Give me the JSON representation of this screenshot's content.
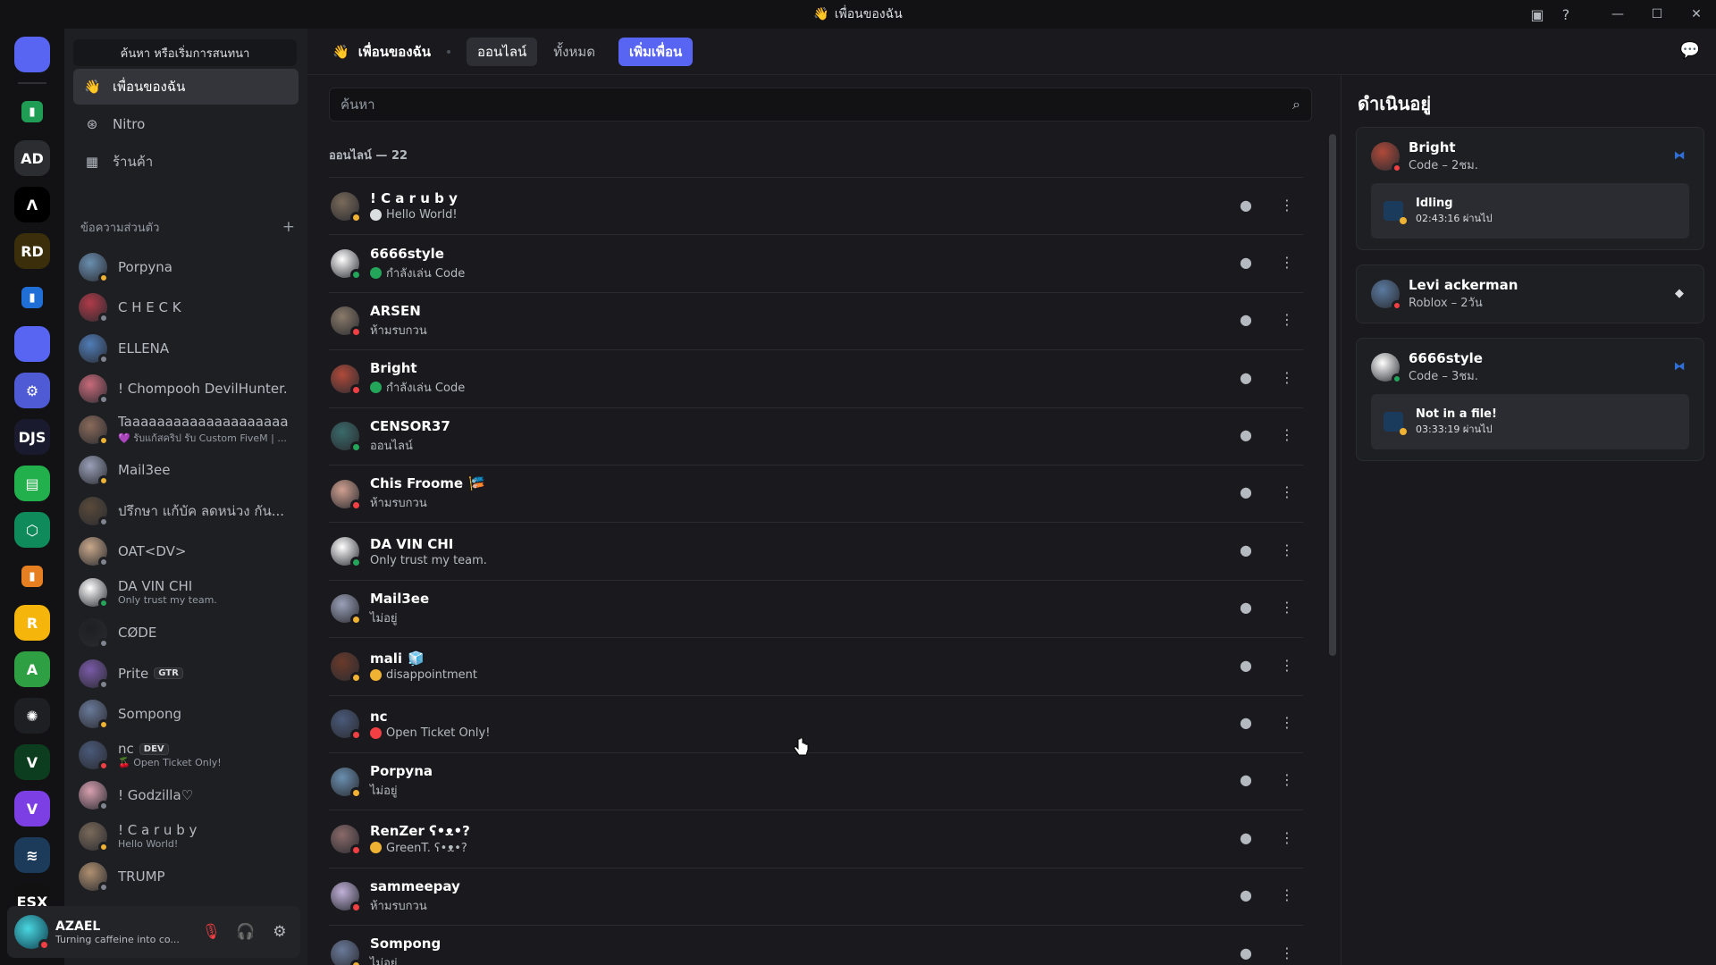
{
  "window": {
    "title": "เพื่อนของฉัน"
  },
  "guilds": [
    {
      "label": "",
      "color": "#5865f2",
      "icon": "discord-home-icon"
    },
    {
      "label": "▮",
      "color": "#1f9d55",
      "icon": "folder-green-icon",
      "folder": true
    },
    {
      "label": "AD",
      "color": "#2b2d31",
      "icon": "ad-server-icon"
    },
    {
      "label": "Ʌ",
      "color": "#000000",
      "icon": "ar-server-icon"
    },
    {
      "label": "RD",
      "color": "#3a2f0a",
      "icon": "rd-server-icon"
    },
    {
      "label": "▮",
      "color": "#1f6fd6",
      "icon": "folder-blue-icon",
      "folder": true
    },
    {
      "label": "",
      "color": "#5865f2",
      "icon": "discord-server-icon"
    },
    {
      "label": "⚙",
      "color": "#4f5bd5",
      "icon": "bot-server-icon"
    },
    {
      "label": "DJS",
      "color": "#1a1a2e",
      "icon": "djs-server-icon"
    },
    {
      "label": "▤",
      "color": "#21b04c",
      "icon": "sheets-server-icon"
    },
    {
      "label": "⬡",
      "color": "#0f8a5b",
      "icon": "hex-server-icon"
    },
    {
      "label": "▮",
      "color": "#e67e22",
      "icon": "folder-orange-icon",
      "folder": true
    },
    {
      "label": "R",
      "color": "#f5b50a",
      "icon": "r-server-icon"
    },
    {
      "label": "A",
      "color": "#2ea043",
      "icon": "a-server-icon"
    },
    {
      "label": "✺",
      "color": "#1e1f23",
      "icon": "atom-server-icon"
    },
    {
      "label": "V",
      "color": "#0b3d1e",
      "icon": "v-server-icon"
    },
    {
      "label": "V",
      "color": "#7b3fe4",
      "icon": "vite-server-icon"
    },
    {
      "label": "≋",
      "color": "#1c3a5a",
      "icon": "wave-server-icon"
    },
    {
      "label": "ESX",
      "color": "#111111",
      "icon": "esx-server-icon"
    }
  ],
  "sidebar": {
    "search_label": "ค้นหา หรือเริ่มการสนทนา",
    "nav": [
      {
        "label": "เพื่อนของฉัน",
        "icon": "friends-icon",
        "active": true
      },
      {
        "label": "Nitro",
        "icon": "nitro-icon",
        "active": false
      },
      {
        "label": "ร้านค้า",
        "icon": "shop-icon",
        "active": false
      }
    ],
    "dm_header": "ข้อความส่วนตัว",
    "dm_add": "+",
    "dms": [
      {
        "name": "Porpyna",
        "sub": "",
        "color": "#6a8fb0",
        "status": "#f0b232"
      },
      {
        "name": "C H E C K",
        "sub": "",
        "color": "#b03a48",
        "status": "#80848e"
      },
      {
        "name": "ELLENA",
        "sub": "",
        "color": "#4f7db8",
        "status": "#80848e"
      },
      {
        "name": "! Chompooh DevilHunter...",
        "sub": "",
        "color": "#c96a7a",
        "status": "#80848e"
      },
      {
        "name": "Taaaaaaaaaaaaaaaaaaaa...",
        "sub": "💜 รับแก้สคริป รับ Custom FiveM | ...",
        "color": "#8a6a5a",
        "status": "#f0b232"
      },
      {
        "name": "Mail3ee",
        "sub": "",
        "color": "#9aa0b8",
        "status": "#f0b232"
      },
      {
        "name": "ปรึกษา แก้บัค ลดหน่วง กัน...",
        "sub": "",
        "color": "#5a4a3a",
        "status": "#80848e"
      },
      {
        "name": "OAT<DV>",
        "sub": "",
        "color": "#c9a88a",
        "status": "#80848e"
      },
      {
        "name": "DA VIN CHI",
        "sub": "Only trust my team.",
        "color": "#ffffff",
        "status": "#23a55a"
      },
      {
        "name": "CØDE",
        "sub": "",
        "color": "#1e1f23",
        "status": "#80848e"
      },
      {
        "name": "Prite",
        "sub": "",
        "tag": "GTR",
        "color": "#7a5aa8",
        "status": "#80848e"
      },
      {
        "name": "Sompong",
        "sub": "",
        "color": "#6a7a9a",
        "status": "#f0b232"
      },
      {
        "name": "nc",
        "sub": "🍒 Open Ticket Only!",
        "tag": "DEV",
        "color": "#4a5a7a",
        "status": "#f23f43"
      },
      {
        "name": "! Godzilla♡",
        "sub": "",
        "color": "#d8a0b0",
        "status": "#80848e"
      },
      {
        "name": "! C a r u b y",
        "sub": "Hello World!",
        "color": "#7a6a5a",
        "status": "#f0b232"
      },
      {
        "name": "TRUMP",
        "sub": "",
        "color": "#b09070",
        "status": "#80848e"
      }
    ]
  },
  "user_panel": {
    "name": "AZAEL",
    "status": "Turning caffeine into co..."
  },
  "header": {
    "title": "เพื่อนของฉัน",
    "tabs": [
      {
        "label": "ออนไลน์",
        "active": true
      },
      {
        "label": "ทั้งหมด",
        "active": false
      }
    ],
    "add_friend": "เพิ่มเพื่อน"
  },
  "friends": {
    "search_placeholder": "ค้นหา",
    "online_count": "ออนไลน์ — 22",
    "list": [
      {
        "name": "! C a r u b y",
        "sub": "Hello World!",
        "emoji": "#dbdee1",
        "color": "#7a6a5a",
        "status": "#f0b232"
      },
      {
        "name": "6666style",
        "sub": "กำลังเล่น Code",
        "emoji": "#23a55a",
        "color": "#ffffff",
        "status": "#23a55a"
      },
      {
        "name": "ARSEN",
        "sub": "ห้ามรบกวน",
        "emoji": "",
        "color": "#8a7a6a",
        "status": "#f23f43"
      },
      {
        "name": "Bright",
        "sub": "กำลังเล่น Code",
        "emoji": "#23a55a",
        "color": "#b04a3a",
        "status": "#f23f43"
      },
      {
        "name": "CENSOR37",
        "sub": "ออนไลน์",
        "emoji": "",
        "color": "#3a6a6a",
        "status": "#23a55a"
      },
      {
        "name": "Chis Froome",
        "sub": "ห้ามรบกวน",
        "emoji": "",
        "badge": "🎏",
        "color": "#d0a090",
        "status": "#f23f43"
      },
      {
        "name": "DA VIN CHI",
        "sub": "Only trust my team.",
        "emoji": "",
        "color": "#ffffff",
        "status": "#23a55a"
      },
      {
        "name": "Mail3ee",
        "sub": "ไม่อยู่",
        "emoji": "",
        "color": "#9aa0b8",
        "status": "#f0b232"
      },
      {
        "name": "mali",
        "sub": "disappointment",
        "emoji": "#f0b232",
        "badge": "🧊",
        "color": "#6a3a2a",
        "status": "#f0b232"
      },
      {
        "name": "nc",
        "sub": "Open Ticket Only!",
        "emoji": "#f23f43",
        "color": "#4a5a7a",
        "status": "#f23f43"
      },
      {
        "name": "Porpyna",
        "sub": "ไม่อยู่",
        "emoji": "",
        "color": "#6a8fb0",
        "status": "#f0b232"
      },
      {
        "name": "RenZer ʕ•ᴥ•?",
        "sub": "GreenT. ʕ•ᴥ•?",
        "emoji": "#f0b232",
        "color": "#8a6a6a",
        "status": "#f23f43"
      },
      {
        "name": "sammeepay",
        "sub": "ห้ามรบกวน",
        "emoji": "",
        "color": "#c0b0d8",
        "status": "#f23f43"
      },
      {
        "name": "Sompong",
        "sub": "ไม่อยู่",
        "emoji": "",
        "color": "#6a7a9a",
        "status": "#f0b232"
      }
    ]
  },
  "active_now": {
    "title": "ดำเนินอยู่",
    "cards": [
      {
        "name": "Bright",
        "sub": "Code – 2ชม.",
        "color": "#b04a3a",
        "status": "#f23f43",
        "icon_color": "#2f6fd6",
        "icon": "vscode-icon",
        "detail": {
          "title": "Idling",
          "time": "02:43:16 ผ่านไป"
        }
      },
      {
        "name": "Levi ackerman",
        "sub": "Roblox – 2วัน",
        "color": "#5a7aa0",
        "status": "#f23f43",
        "icon_color": "#dbdee1",
        "icon": "roblox-icon",
        "detail": null
      },
      {
        "name": "6666style",
        "sub": "Code – 3ชม.",
        "color": "#ffffff",
        "status": "#23a55a",
        "icon_color": "#2f6fd6",
        "icon": "vscode-icon",
        "detail": {
          "title": "Not in a file!",
          "time": "03:33:19 ผ่านไป"
        }
      }
    ]
  }
}
